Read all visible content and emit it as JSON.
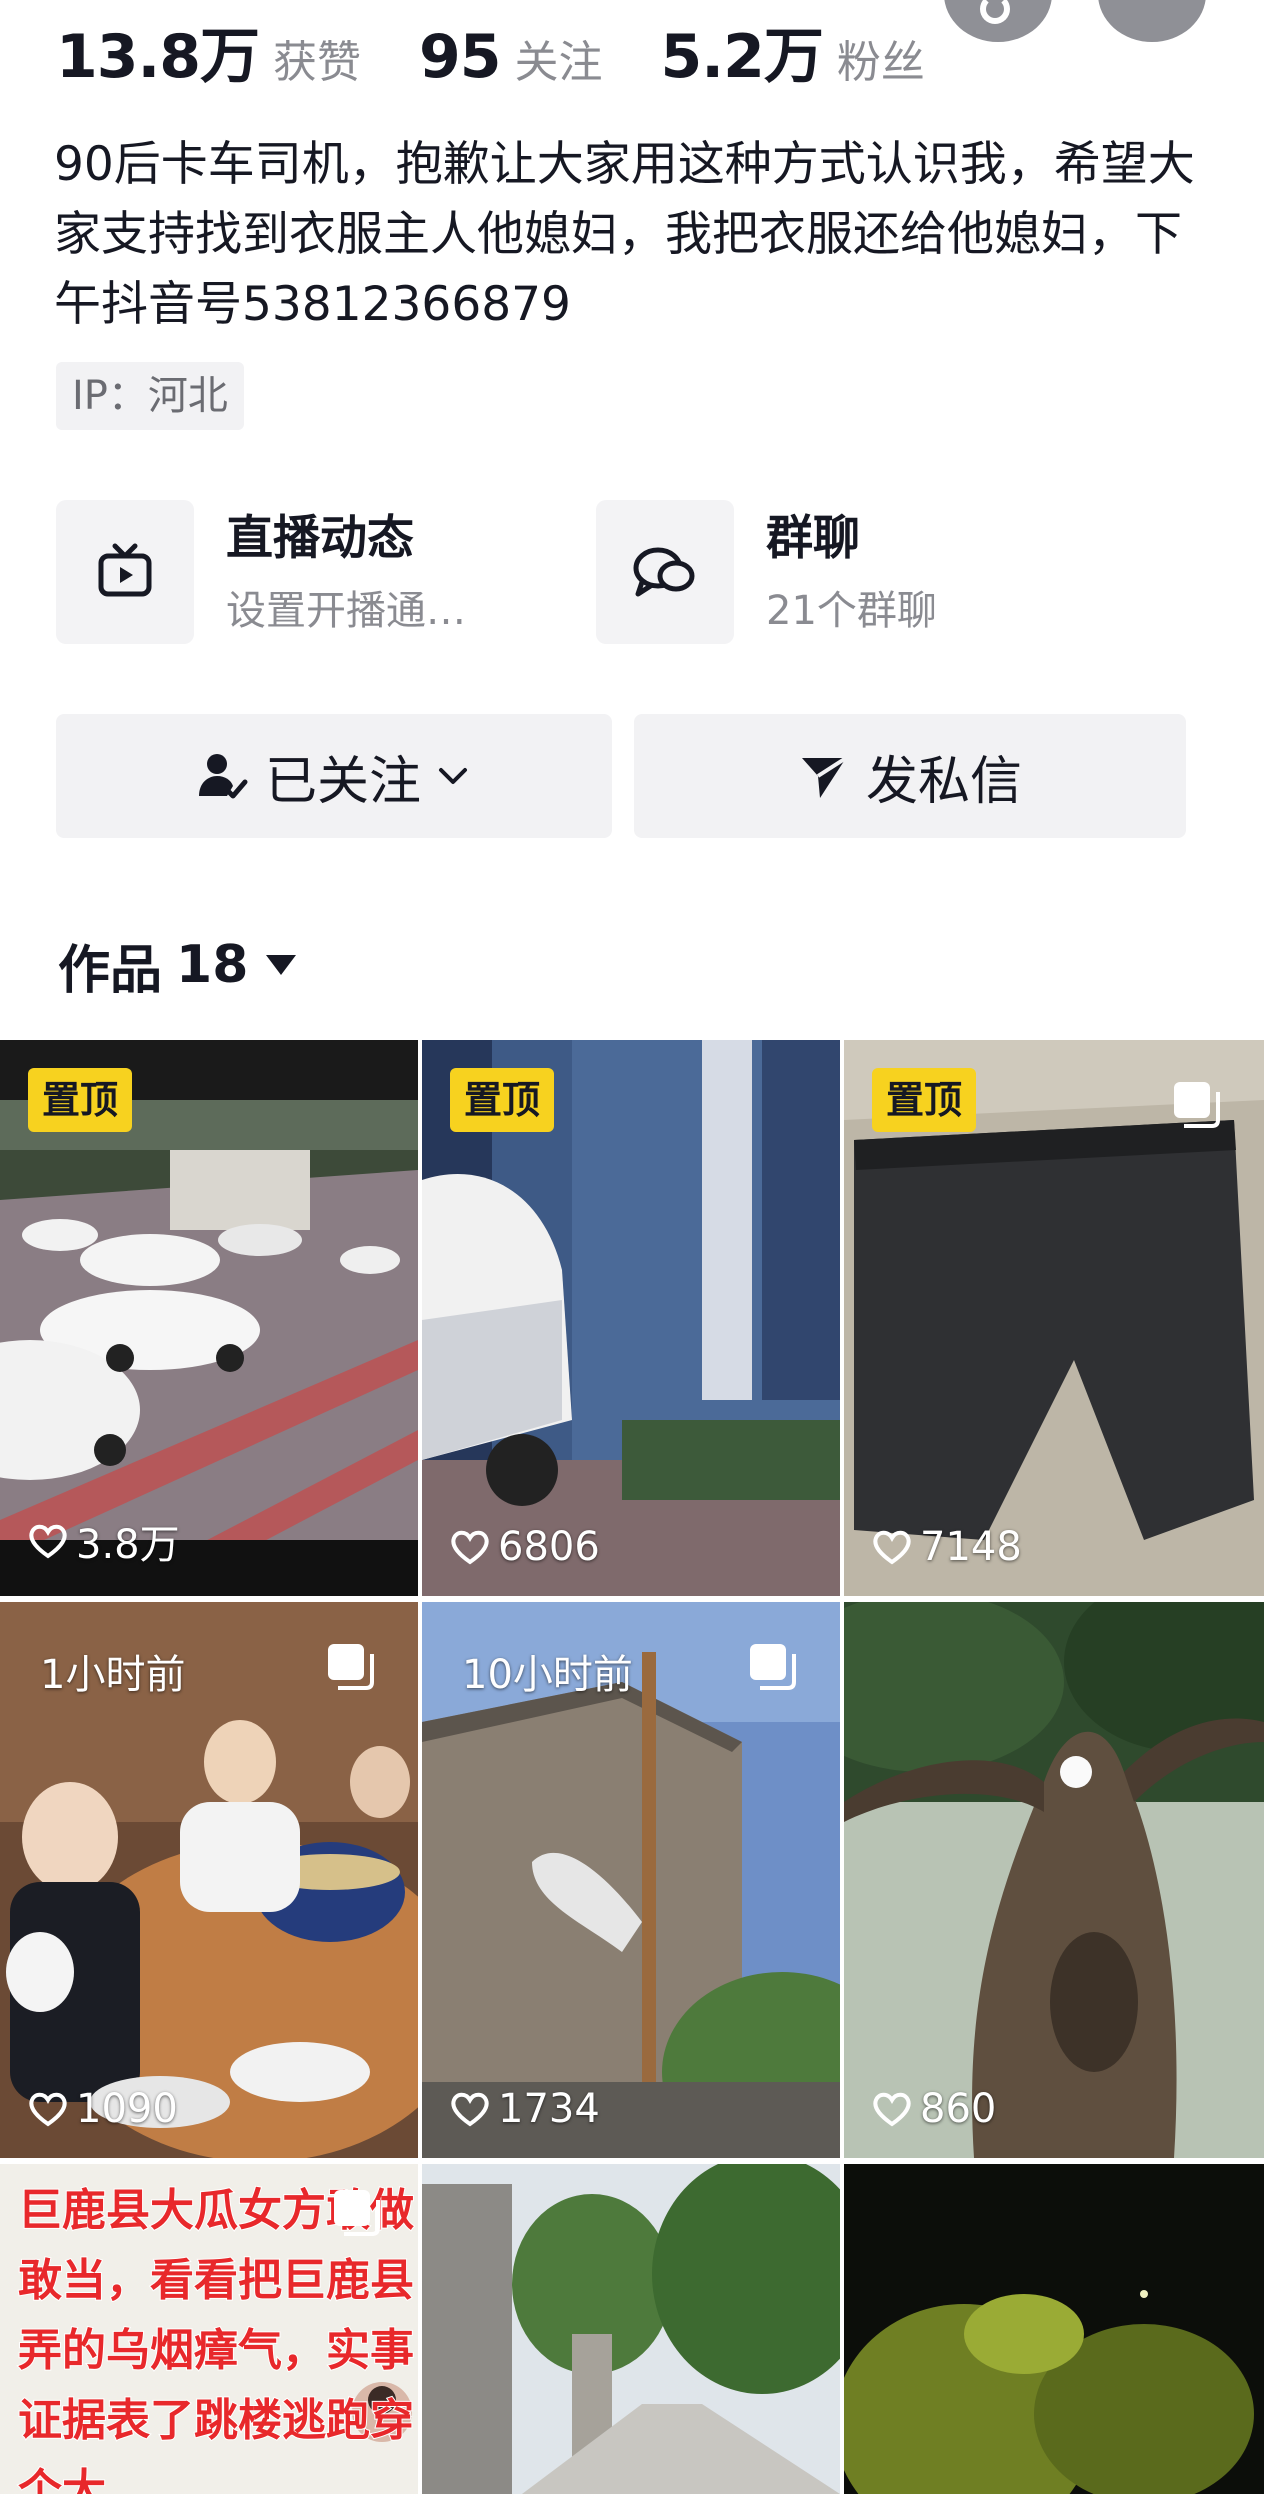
{
  "stats": [
    {
      "num": "13.8万",
      "label": "获赞"
    },
    {
      "num": "95",
      "label": "关注"
    },
    {
      "num": "5.2万",
      "label": "粉丝"
    }
  ],
  "bio": "90后卡车司机，抱歉让大家用这种方式认识我，希望大家支持找到衣服主人他媳妇，我把衣服还给他媳妇，下午抖音号53812366879",
  "ip": "IP：河北",
  "features": {
    "live": {
      "title": "直播动态",
      "sub": "设置开播通…",
      "icon": "tv-icon"
    },
    "group": {
      "title": "群聊",
      "sub": "21个群聊",
      "icon": "chat-bubble-icon"
    }
  },
  "actions": {
    "follow": "已关注",
    "message": "发私信"
  },
  "tab": {
    "label": "作品",
    "count": "18"
  },
  "videos": [
    {
      "pin": "置顶",
      "likes": "3.8万",
      "time": "",
      "multi": false
    },
    {
      "pin": "置顶",
      "likes": "6806",
      "time": "",
      "multi": false
    },
    {
      "pin": "置顶",
      "likes": "7148",
      "time": "",
      "multi": true
    },
    {
      "pin": "",
      "likes": "1090",
      "time": "1小时前",
      "multi": true
    },
    {
      "pin": "",
      "likes": "1734",
      "time": "10小时前",
      "multi": true
    },
    {
      "pin": "",
      "likes": "860",
      "time": "",
      "multi": false
    },
    {
      "pin": "",
      "likes": "",
      "time": "",
      "overlay": "巨鹿县大瓜女方敢做敢当，看看把巨鹿县弄的乌烟瘴气，实事证据表了跳楼逃跑穿个大",
      "multi": true
    },
    {
      "pin": "",
      "likes": "",
      "time": "",
      "multi": false
    },
    {
      "pin": "",
      "likes": "",
      "time": "",
      "multi": false
    }
  ],
  "colors": {
    "pin": "#f7d21f",
    "overlay_text": "#e8282b",
    "muted": "#8a8b91"
  }
}
